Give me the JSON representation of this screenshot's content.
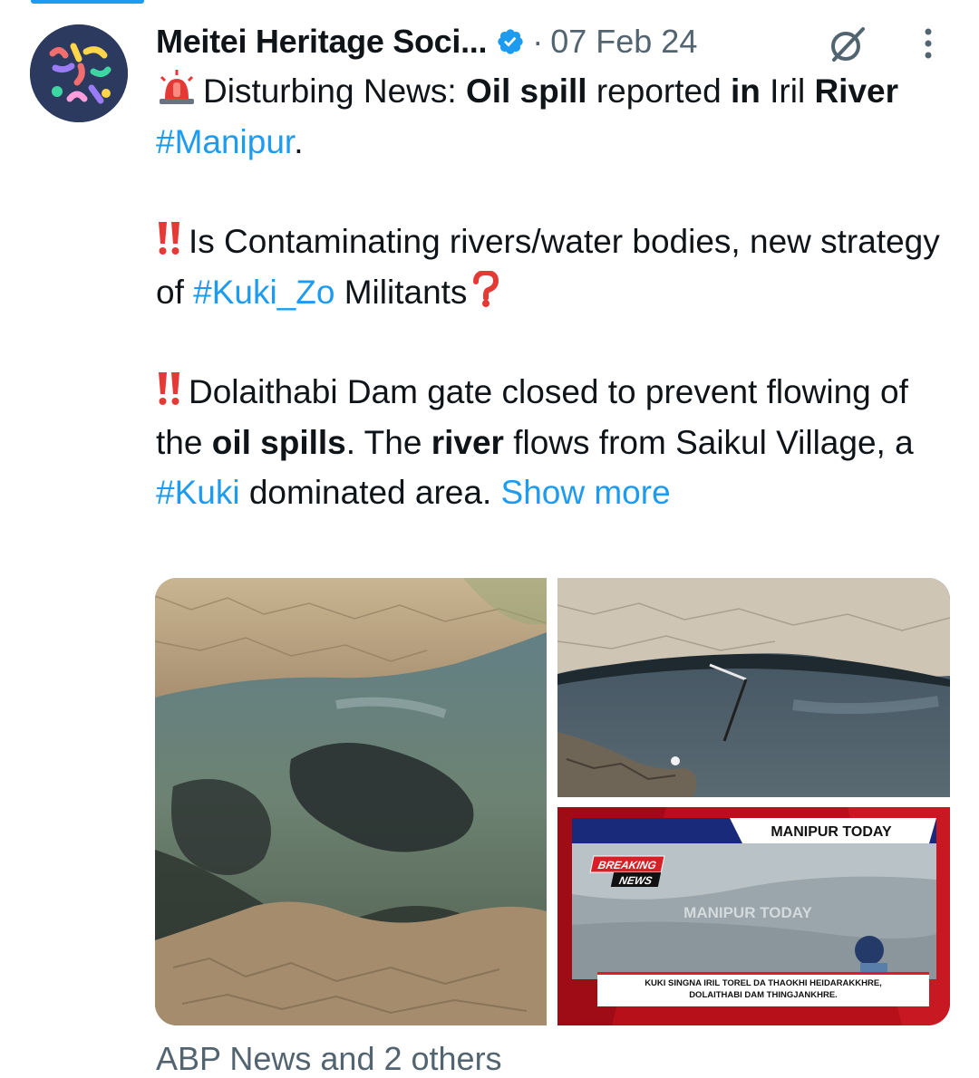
{
  "account": {
    "display_name": "Meitei Heritage Soci...",
    "separator": "·",
    "date": "07 Feb 24"
  },
  "icons": {
    "verified": "verified-badge-icon",
    "grok": "grok-icon",
    "more": "more-options-icon",
    "siren": "police-light-emoji",
    "double_exclamation": "double-exclamation-emoji",
    "question": "red-question-mark-emoji"
  },
  "tweet": {
    "p1": {
      "s1": "Disturbing News: ",
      "s2": "Oil spill",
      "s3": " reported ",
      "s4": "in",
      "s5": " Iril ",
      "s6": "River",
      "s7": " ",
      "h1": "#Manipur",
      "s8": "."
    },
    "p2": {
      "s1": "Is Contaminating rivers/water bodies, new strategy of ",
      "h1": "#Kuki_Zo",
      "s2": " Militants"
    },
    "p3": {
      "s1": "Dolaithabi Dam gate closed to prevent flowing of the ",
      "s2": "oil spills",
      "s3": ". The ",
      "s4": "river",
      "s5": " flows from Saikul Village, a ",
      "h1": "#Kuki",
      "s6": " dominated area. ",
      "show_more": "Show more"
    }
  },
  "media": {
    "news_screen": {
      "channel": "MANIPUR TODAY",
      "breaking": "BREAKING",
      "news": "NEWS",
      "watermark": "MANIPUR TODAY",
      "ticker_line1": "KUKI SINGNA IRIL TOREL DA THAOKHI HEIDARAKKHRE,",
      "ticker_line2": "DOLAITHABI DAM THINGJANKHRE."
    }
  },
  "colors": {
    "link": "#1d9bf0",
    "text": "#0f1419",
    "muted": "#536471",
    "avatar_bg": "#2b3a5e",
    "news_red": "#b8101a"
  },
  "footer": {
    "peek_text": "ABP News and 2 others"
  }
}
